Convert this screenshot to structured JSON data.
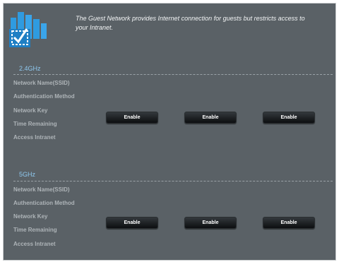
{
  "header": {
    "icon": "guest-network-icon",
    "description": "The Guest Network provides Internet connection for guests but restricts access to your Intranet."
  },
  "bands": [
    {
      "title": "2.4GHz",
      "fields": [
        "Network Name(SSID)",
        "Authentication Method",
        "Network Key",
        "Time Remaining",
        "Access Intranet"
      ],
      "buttons": [
        "Enable",
        "Enable",
        "Enable"
      ]
    },
    {
      "title": "5GHz",
      "fields": [
        "Network Name(SSID)",
        "Authentication Method",
        "Network Key",
        "Time Remaining",
        "Access Intranet"
      ],
      "buttons": [
        "Enable",
        "Enable",
        "Enable"
      ]
    }
  ],
  "colors": {
    "panel_background": "#5a6166",
    "band_title": "#8ec8ef",
    "label_text": "#aeb4b8",
    "button_background": "#0c0e10",
    "icon_blue": "#2f9be0"
  }
}
